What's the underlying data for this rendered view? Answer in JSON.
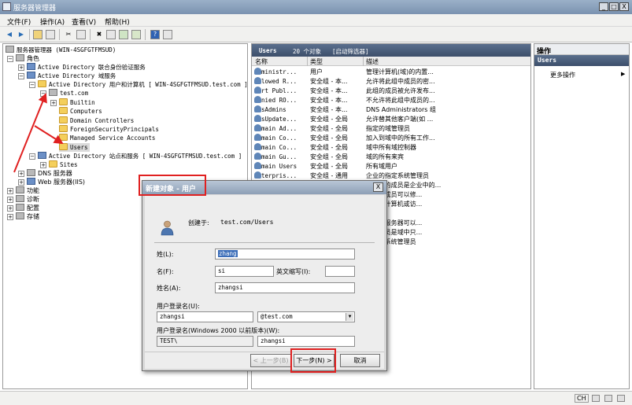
{
  "window": {
    "title": "服务器管理器",
    "controls": {
      "minimize": "_",
      "maximize": "□",
      "close": "X"
    }
  },
  "menu": [
    "文件(F)",
    "操作(A)",
    "查看(V)",
    "帮助(H)"
  ],
  "tree": {
    "root": "服务器管理器 (WIN-4SGFGTFMSUD)",
    "roles": "角色",
    "adfs": "Active Directory 联合身份验证服务",
    "adds": "Active Directory 域服务",
    "aduc": "Active Directory 用户和计算机 [ WIN-4SGFGTFMSUD.test.com ]",
    "domain": "test.com",
    "builtin": "Builtin",
    "computers": "Computers",
    "dcs": "Domain Controllers",
    "fsp": "ForeignSecurityPrincipals",
    "msa": "Managed Service Accounts",
    "users": "Users",
    "adss": "Active Directory 站点和服务 [ WIN-4SGFGTFMSUD.test.com ]",
    "sites": "Sites",
    "dns": "DNS 服务器",
    "iis": "Web 服务器(IIS)",
    "features": "功能",
    "diagnostics": "诊断",
    "config": "配置",
    "storage": "存储"
  },
  "list": {
    "header_title": "Users",
    "header_count": "20 个对象",
    "header_filter": "[启动筛选器]",
    "columns": [
      "名称",
      "类型",
      "描述"
    ],
    "rows": [
      {
        "name": "Administr...",
        "type": "用户",
        "desc": "管理计算机(域)的内置..."
      },
      {
        "name": "Allowed R...",
        "type": "安全组 - 本...",
        "desc": "允许将此组中成员的密..."
      },
      {
        "name": "Cert Publ...",
        "type": "安全组 - 本...",
        "desc": "此组的成员被允许发布..."
      },
      {
        "name": "Denied RO...",
        "type": "安全组 - 本...",
        "desc": "不允许将此组中成员的..."
      },
      {
        "name": "DnsAdmins",
        "type": "安全组 - 本...",
        "desc": "DNS Administrators 组"
      },
      {
        "name": "DnsUpdate...",
        "type": "安全组 - 全局",
        "desc": "允许替其他客户端(如 ..."
      },
      {
        "name": "Domain Ad...",
        "type": "安全组 - 全局",
        "desc": "指定的域管理员"
      },
      {
        "name": "Domain Co...",
        "type": "安全组 - 全局",
        "desc": "加入到域中的所有工作..."
      },
      {
        "name": "Domain Co...",
        "type": "安全组 - 全局",
        "desc": "域中所有域控制器"
      },
      {
        "name": "Domain Gu...",
        "type": "安全组 - 全局",
        "desc": "域的所有来宾"
      },
      {
        "name": "Domain Users",
        "type": "安全组 - 全局",
        "desc": "所有域用户"
      },
      {
        "name": "Enterpris...",
        "type": "安全组 - 通用",
        "desc": "企业的指定系统管理员"
      },
      {
        "name": "",
        "type": "",
        "desc": "...该组的成员是企业中的..."
      },
      {
        "name": "",
        "type": "",
        "desc": "...中的成员可以修..."
      },
      {
        "name": "",
        "type": "",
        "desc": "...访问计算机或访..."
      },
      {
        "name": "",
        "type": "",
        "desc": ""
      },
      {
        "name": "",
        "type": "",
        "desc": "...中的服务器可以..."
      },
      {
        "name": "",
        "type": "",
        "desc": "...的成员是域中只..."
      },
      {
        "name": "",
        "type": "",
        "desc": "...指定系统管理员"
      }
    ]
  },
  "actions": {
    "title": "操作",
    "section": "Users",
    "more": "更多操作",
    "more_arrow": "▶"
  },
  "dialog": {
    "title": "新建对象 - 用户",
    "close": "X",
    "created_in_label": "创建于:",
    "created_in_value": "test.com/Users",
    "last_name_label": "姓(L):",
    "last_name_value": "zhang",
    "first_name_label": "名(F):",
    "first_name_value": "si",
    "initials_label": "英文缩写(I):",
    "initials_value": "",
    "full_name_label": "姓名(A):",
    "full_name_value": "zhangsi",
    "logon_label": "用户登录名(U):",
    "logon_value": "zhangsi",
    "domain_suffix": "@test.com",
    "logon_pre2000_label": "用户登录名(Windows 2000 以前版本)(W):",
    "domain_prefix": "TEST\\",
    "logon_pre2000_value": "zhangsi",
    "back_button": "< 上一步(B)",
    "next_button": "下一步(N) >",
    "cancel_button": "取消"
  },
  "status": {
    "lang": "CH"
  },
  "colors": {
    "annotation": "#e02020",
    "header_dark": "#3d4f6b"
  }
}
